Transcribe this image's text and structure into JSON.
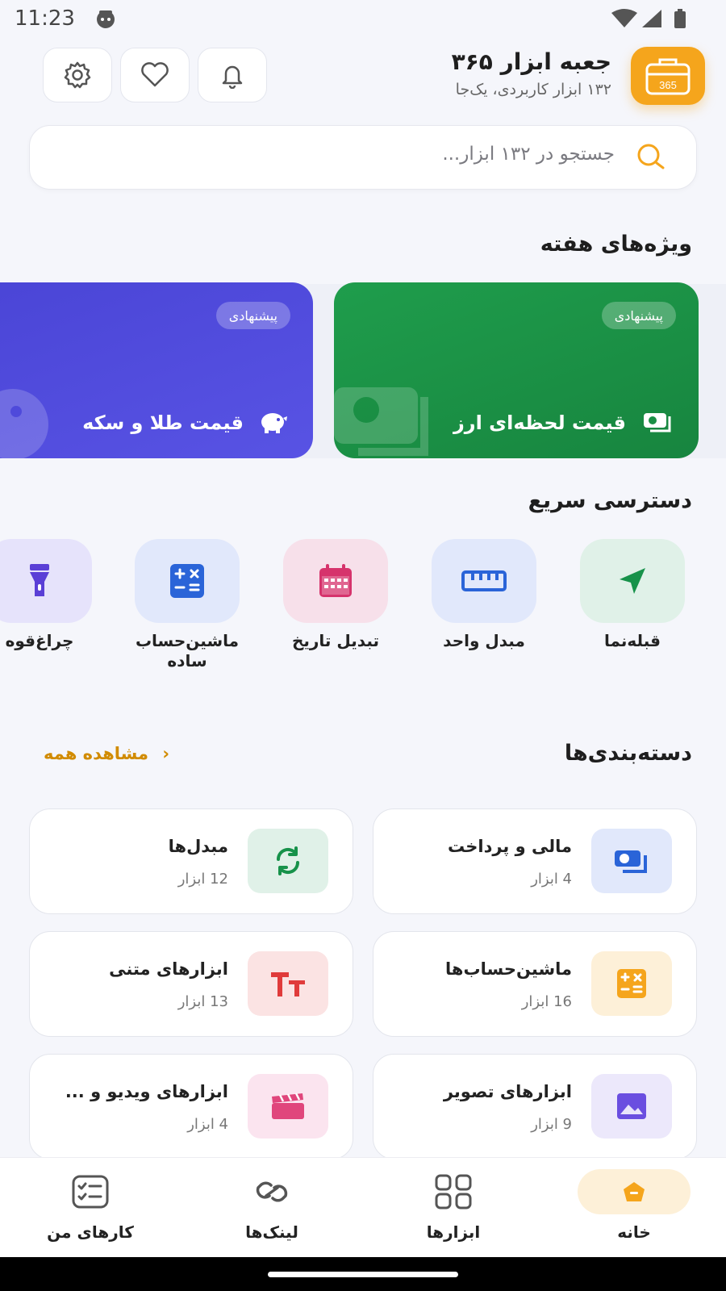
{
  "status_bar": {
    "time": "11:23"
  },
  "header": {
    "title": "جعبه ابزار ۳۶۵",
    "subtitle": "۱۳۲ ابزار کاربردی، یک‌جا",
    "logo_text": "365",
    "accent_color": "#f5a51c"
  },
  "search": {
    "placeholder": "جستجو در ۱۳۲ ابزار..."
  },
  "weekly": {
    "title": "ویژه‌های هفته",
    "cards": [
      {
        "badge": "پیشنهادی",
        "label": "قیمت لحظه‌ای ارز",
        "icon": "money-icon",
        "color": "#1f9d4c"
      },
      {
        "badge": "پیشنهادی",
        "label": "قیمت طلا و سکه",
        "icon": "piggy-bank-icon",
        "color": "#4a45d6"
      }
    ]
  },
  "quick": {
    "title": "دسترسی سریع",
    "items": [
      {
        "label": "قبله‌نما",
        "icon": "navigation-arrow-icon"
      },
      {
        "label": "مبدل واحد",
        "icon": "ruler-icon"
      },
      {
        "label": "تبدیل تاریخ",
        "icon": "calendar-icon"
      },
      {
        "label": "ماشین‌حساب ساده",
        "icon": "calculator-icon"
      },
      {
        "label": "چراغ‌قوه",
        "icon": "flashlight-icon"
      }
    ]
  },
  "categories": {
    "title": "دسته‌بندی‌ها",
    "see_all": "مشاهده همه",
    "items": [
      {
        "name": "مالی و پرداخت",
        "count": "4 ابزار",
        "icon": "money-icon"
      },
      {
        "name": "مبدل‌ها",
        "count": "12 ابزار",
        "icon": "refresh-icon"
      },
      {
        "name": "ماشین‌حساب‌ها",
        "count": "16 ابزار",
        "icon": "calculator-icon"
      },
      {
        "name": "ابزارهای متنی",
        "count": "13 ابزار",
        "icon": "text-size-icon"
      },
      {
        "name": "ابزارهای تصویر",
        "count": "9 ابزار",
        "icon": "image-icon"
      },
      {
        "name": "ابزارهای ویدیو و ...",
        "count": "4 ابزار",
        "icon": "clapperboard-icon"
      }
    ]
  },
  "bottom_nav": {
    "items": [
      {
        "label": "خانه",
        "icon": "home-icon",
        "active": true
      },
      {
        "label": "ابزارها",
        "icon": "grid-icon",
        "active": false
      },
      {
        "label": "لینک‌ها",
        "icon": "link-icon",
        "active": false
      },
      {
        "label": "کارهای من",
        "icon": "checklist-icon",
        "active": false
      }
    ]
  }
}
